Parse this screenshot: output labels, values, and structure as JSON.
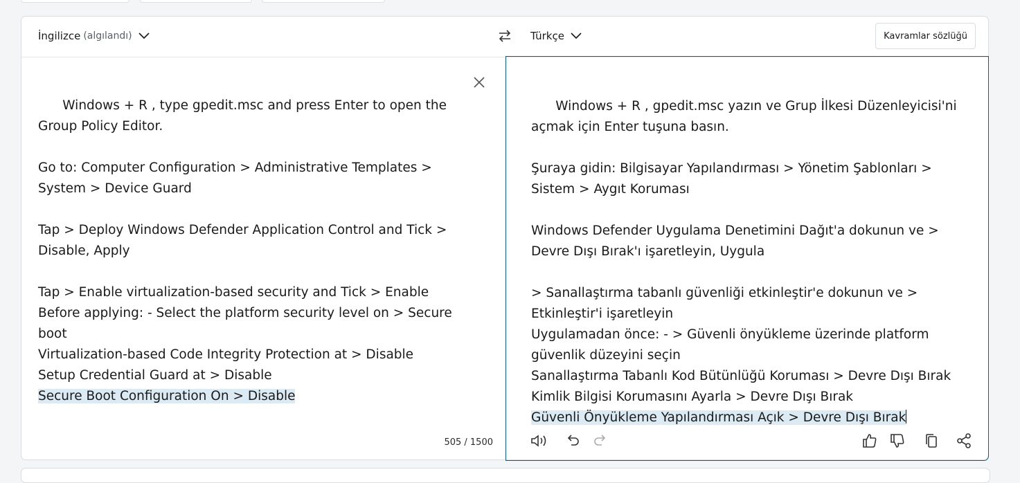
{
  "header": {
    "source_lang": "İngilizce",
    "source_detected": "(algılandı)",
    "target_lang": "Türkçe",
    "glossary_label": "Kavramlar sözlüğü"
  },
  "source": {
    "paragraphs": [
      "Windows + R , type gpedit.msc and press Enter to open the Group Policy Editor.",
      "",
      "Go to: Computer Configuration > Administrative Templates > System > Device Guard",
      "",
      "Tap > Deploy Windows Defender Application Control and Tick > Disable, Apply",
      "",
      "Tap > Enable virtualization-based security and Tick > Enable",
      "Before applying: - Select the platform security level on > Secure boot",
      "Virtualization-based Code Integrity Protection at > Disable",
      "Setup Credential Guard at > Disable"
    ],
    "highlighted_line": "Secure Boot Configuration On > Disable",
    "char_count": "505 / 1500"
  },
  "target": {
    "paragraphs": [
      "Windows + R , gpedit.msc yazın ve Grup İlkesi Düzenleyicisi'ni açmak için Enter tuşuna basın.",
      "",
      "Şuraya gidin: Bilgisayar Yapılandırması > Yönetim Şablonları > Sistem > Aygıt Koruması",
      "",
      "Windows Defender Uygulama Denetimini Dağıt'a dokunun ve > Devre Dışı Bırak'ı işaretleyin, Uygula",
      "",
      "> Sanallaştırma tabanlı güvenliği etkinleştir'e dokunun ve > Etkinleştir'i işaretleyin",
      "Uygulamadan önce: - > Güvenli önyükleme üzerinde platform güvenlik düzeyini seçin",
      "Sanallaştırma Tabanlı Kod Bütünlüğü Koruması > Devre Dışı Bırak",
      "Kimlik Bilgisi Korumasını Ayarla > Devre Dışı Bırak"
    ],
    "highlighted_line": "Güvenli Önyükleme Yapılandırması Açık > Devre Dışı Bırak"
  },
  "icons": {
    "speaker": "speaker-icon",
    "undo": "undo-icon",
    "redo": "redo-icon",
    "like": "thumbs-up-icon",
    "dislike": "thumbs-down-icon",
    "copy": "copy-icon",
    "share": "share-icon"
  },
  "colors": {
    "accent_border": "#0a5d8a",
    "highlight": "#dbeaf3"
  }
}
